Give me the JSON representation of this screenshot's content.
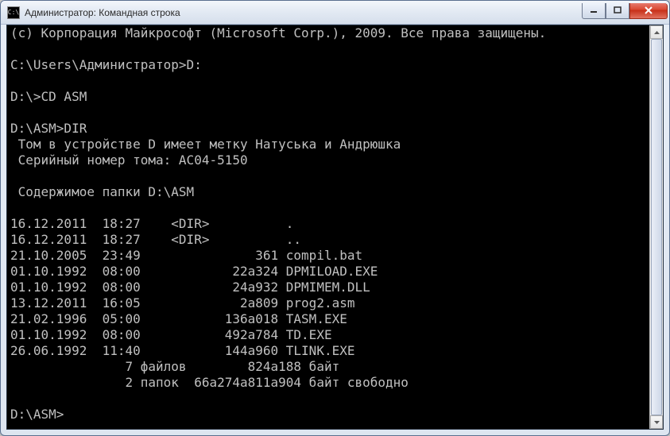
{
  "window": {
    "title": "Администратор: Командная строка"
  },
  "terminal": {
    "copyright": "(c) Корпорация Майкрософт (Microsoft Corp.), 2009. Все права защищены.",
    "prompt1": "C:\\Users\\Администратор>D:",
    "prompt2": "D:\\>CD ASM",
    "prompt3": "D:\\ASM>DIR",
    "volume_label": " Том в устройстве D имеет метку Натуська и Андрюшка",
    "serial": " Серийный номер тома: AC04-5150",
    "contents_of": " Содержимое папки D:\\ASM",
    "rows": [
      "16.12.2011  18:27    <DIR>          .",
      "16.12.2011  18:27    <DIR>          ..",
      "21.10.2005  23:49               361 compil.bat",
      "01.10.1992  08:00            22а324 DPMILOAD.EXE",
      "01.10.1992  08:00            24а932 DPMIMEM.DLL",
      "13.12.2011  16:05             2а809 prog2.asm",
      "21.02.1996  05:00           136а018 TASM.EXE",
      "01.10.1992  08:00           492а784 TD.EXE",
      "26.06.1992  11:40           144а960 TLINK.EXE"
    ],
    "summary_files": "               7 файлов        824а188 байт",
    "summary_dirs": "               2 папок  66а274а811а904 байт свободно",
    "prompt4": "D:\\ASM>"
  }
}
